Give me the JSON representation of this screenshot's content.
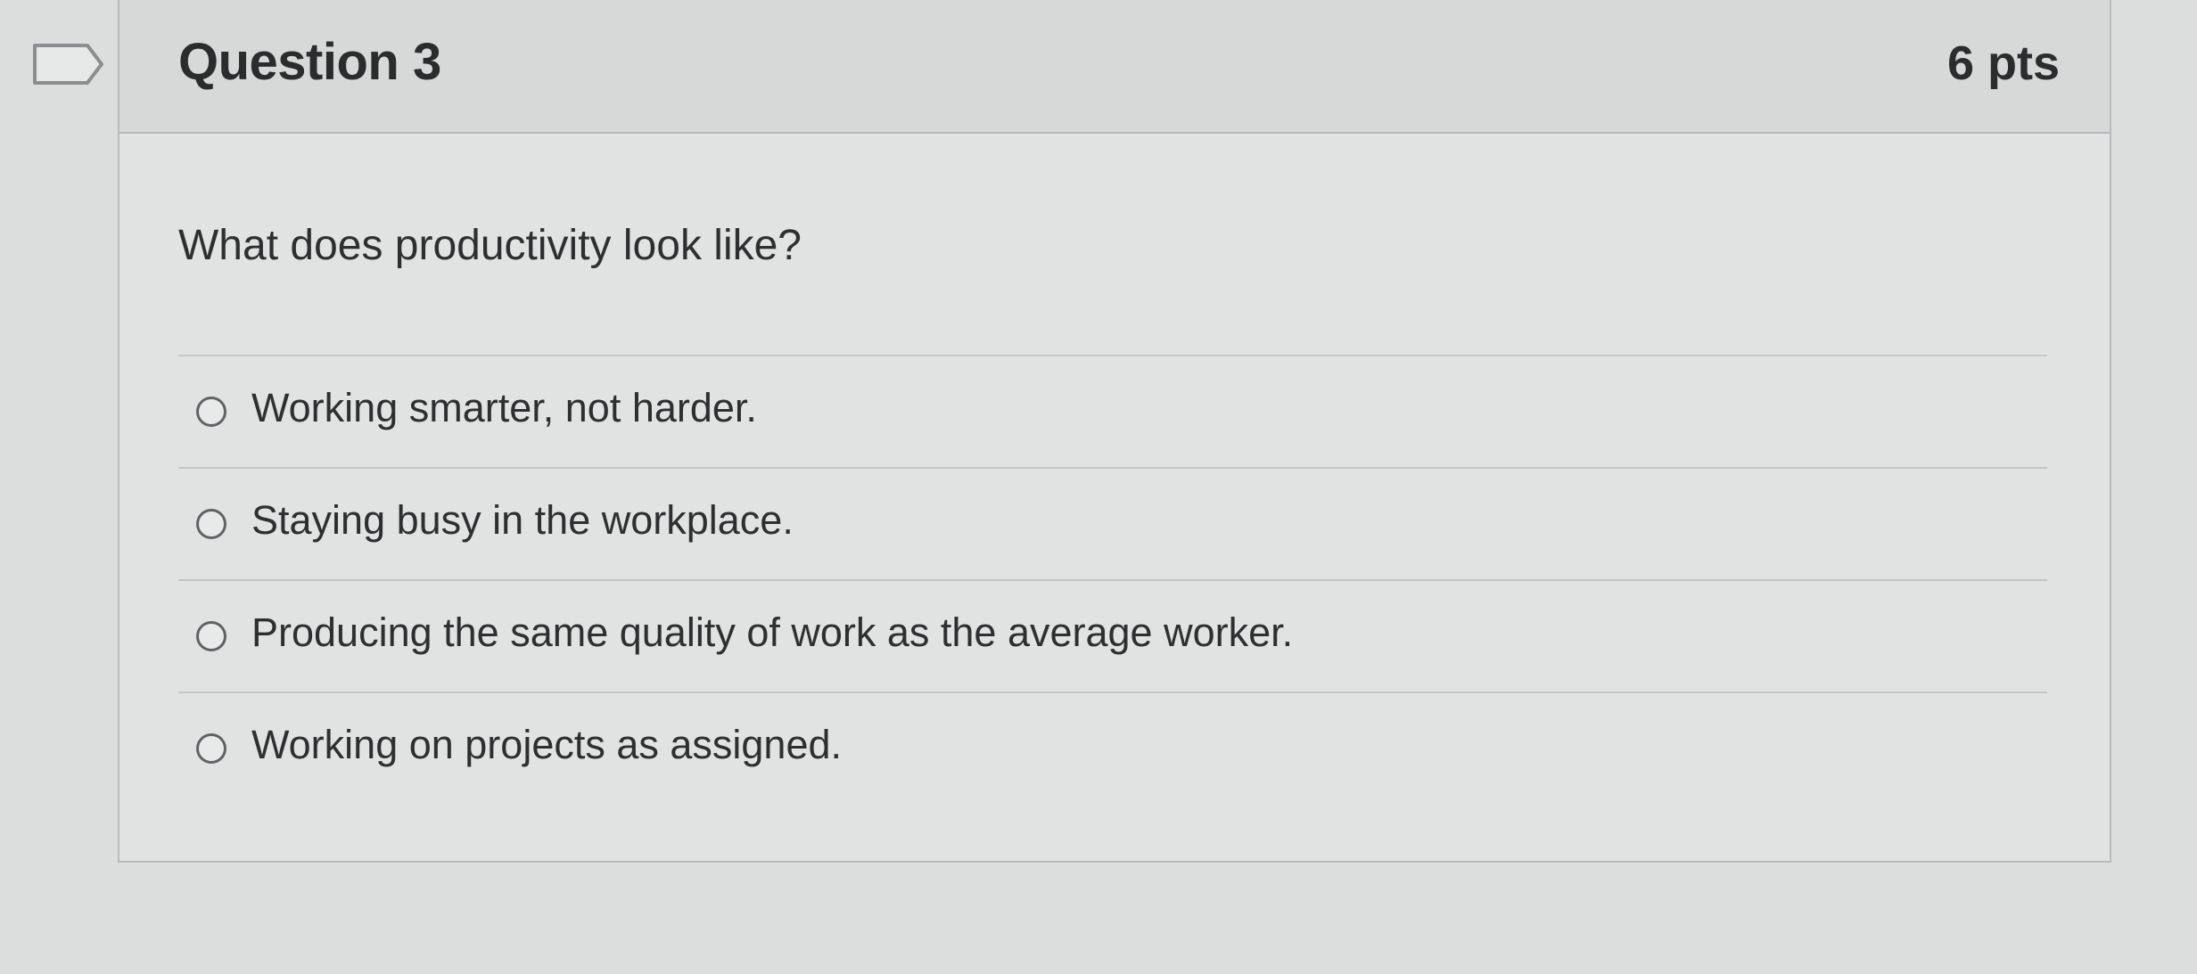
{
  "question": {
    "title": "Question 3",
    "points": "6 pts",
    "text": "What does productivity look like?",
    "flag_icon": "flag-icon"
  },
  "answers": [
    {
      "label": "Working smarter, not harder."
    },
    {
      "label": "Staying busy in the workplace."
    },
    {
      "label": "Producing the same quality of work as the average worker."
    },
    {
      "label": "Working on projects as assigned."
    }
  ]
}
